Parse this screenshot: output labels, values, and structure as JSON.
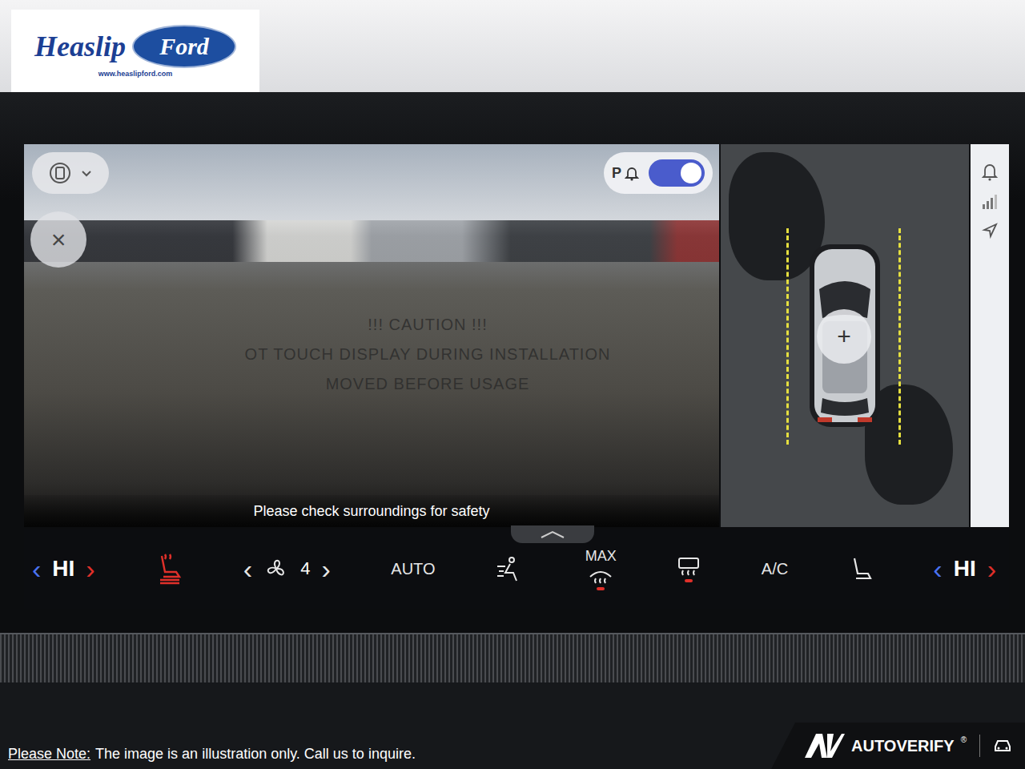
{
  "dealer": {
    "name": "Heaslip",
    "brand": "Ford",
    "url": "www.heaslipford.com"
  },
  "camera": {
    "close": "×",
    "parking_alert": {
      "label": "P",
      "on": true
    },
    "caption": "Please check surroundings for safety",
    "film_notice": [
      "!!! CAUTION !!!",
      "OT TOUCH DISPLAY DURING INSTALLATION",
      "MOVED BEFORE USAGE"
    ]
  },
  "overhead": {
    "zoom": "+"
  },
  "climate": [
    {
      "kind": "temp",
      "prev": "‹",
      "value": "HI",
      "next": "›"
    },
    {
      "kind": "heated-seat",
      "on": true
    },
    {
      "kind": "fan",
      "prev": "‹",
      "value": "4",
      "next": "›"
    },
    {
      "kind": "button",
      "label": "AUTO",
      "on": false
    },
    {
      "kind": "airflow",
      "on": false
    },
    {
      "kind": "max-defrost",
      "label": "MAX",
      "on": true
    },
    {
      "kind": "rear-defrost",
      "on": true
    },
    {
      "kind": "button",
      "label": "A/C",
      "on": false
    },
    {
      "kind": "seat",
      "on": false
    },
    {
      "kind": "temp",
      "prev": "‹",
      "value": "HI",
      "next": "›"
    }
  ],
  "footer": {
    "note_label": "Please Note:",
    "note": "The image is an illustration only. Call us to inquire.",
    "verifier": "AUTOVERIFY",
    "mark": "®"
  }
}
